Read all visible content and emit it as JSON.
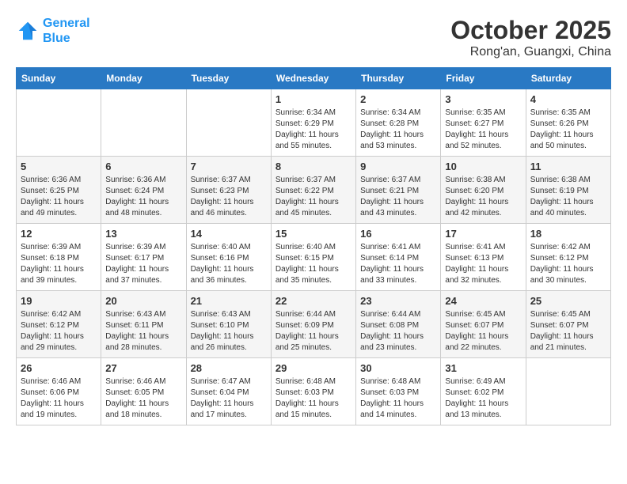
{
  "logo": {
    "line1": "General",
    "line2": "Blue"
  },
  "title": "October 2025",
  "subtitle": "Rong'an, Guangxi, China",
  "weekdays": [
    "Sunday",
    "Monday",
    "Tuesday",
    "Wednesday",
    "Thursday",
    "Friday",
    "Saturday"
  ],
  "weeks": [
    [
      {
        "day": "",
        "info": ""
      },
      {
        "day": "",
        "info": ""
      },
      {
        "day": "",
        "info": ""
      },
      {
        "day": "1",
        "info": "Sunrise: 6:34 AM\nSunset: 6:29 PM\nDaylight: 11 hours\nand 55 minutes."
      },
      {
        "day": "2",
        "info": "Sunrise: 6:34 AM\nSunset: 6:28 PM\nDaylight: 11 hours\nand 53 minutes."
      },
      {
        "day": "3",
        "info": "Sunrise: 6:35 AM\nSunset: 6:27 PM\nDaylight: 11 hours\nand 52 minutes."
      },
      {
        "day": "4",
        "info": "Sunrise: 6:35 AM\nSunset: 6:26 PM\nDaylight: 11 hours\nand 50 minutes."
      }
    ],
    [
      {
        "day": "5",
        "info": "Sunrise: 6:36 AM\nSunset: 6:25 PM\nDaylight: 11 hours\nand 49 minutes."
      },
      {
        "day": "6",
        "info": "Sunrise: 6:36 AM\nSunset: 6:24 PM\nDaylight: 11 hours\nand 48 minutes."
      },
      {
        "day": "7",
        "info": "Sunrise: 6:37 AM\nSunset: 6:23 PM\nDaylight: 11 hours\nand 46 minutes."
      },
      {
        "day": "8",
        "info": "Sunrise: 6:37 AM\nSunset: 6:22 PM\nDaylight: 11 hours\nand 45 minutes."
      },
      {
        "day": "9",
        "info": "Sunrise: 6:37 AM\nSunset: 6:21 PM\nDaylight: 11 hours\nand 43 minutes."
      },
      {
        "day": "10",
        "info": "Sunrise: 6:38 AM\nSunset: 6:20 PM\nDaylight: 11 hours\nand 42 minutes."
      },
      {
        "day": "11",
        "info": "Sunrise: 6:38 AM\nSunset: 6:19 PM\nDaylight: 11 hours\nand 40 minutes."
      }
    ],
    [
      {
        "day": "12",
        "info": "Sunrise: 6:39 AM\nSunset: 6:18 PM\nDaylight: 11 hours\nand 39 minutes."
      },
      {
        "day": "13",
        "info": "Sunrise: 6:39 AM\nSunset: 6:17 PM\nDaylight: 11 hours\nand 37 minutes."
      },
      {
        "day": "14",
        "info": "Sunrise: 6:40 AM\nSunset: 6:16 PM\nDaylight: 11 hours\nand 36 minutes."
      },
      {
        "day": "15",
        "info": "Sunrise: 6:40 AM\nSunset: 6:15 PM\nDaylight: 11 hours\nand 35 minutes."
      },
      {
        "day": "16",
        "info": "Sunrise: 6:41 AM\nSunset: 6:14 PM\nDaylight: 11 hours\nand 33 minutes."
      },
      {
        "day": "17",
        "info": "Sunrise: 6:41 AM\nSunset: 6:13 PM\nDaylight: 11 hours\nand 32 minutes."
      },
      {
        "day": "18",
        "info": "Sunrise: 6:42 AM\nSunset: 6:12 PM\nDaylight: 11 hours\nand 30 minutes."
      }
    ],
    [
      {
        "day": "19",
        "info": "Sunrise: 6:42 AM\nSunset: 6:12 PM\nDaylight: 11 hours\nand 29 minutes."
      },
      {
        "day": "20",
        "info": "Sunrise: 6:43 AM\nSunset: 6:11 PM\nDaylight: 11 hours\nand 28 minutes."
      },
      {
        "day": "21",
        "info": "Sunrise: 6:43 AM\nSunset: 6:10 PM\nDaylight: 11 hours\nand 26 minutes."
      },
      {
        "day": "22",
        "info": "Sunrise: 6:44 AM\nSunset: 6:09 PM\nDaylight: 11 hours\nand 25 minutes."
      },
      {
        "day": "23",
        "info": "Sunrise: 6:44 AM\nSunset: 6:08 PM\nDaylight: 11 hours\nand 23 minutes."
      },
      {
        "day": "24",
        "info": "Sunrise: 6:45 AM\nSunset: 6:07 PM\nDaylight: 11 hours\nand 22 minutes."
      },
      {
        "day": "25",
        "info": "Sunrise: 6:45 AM\nSunset: 6:07 PM\nDaylight: 11 hours\nand 21 minutes."
      }
    ],
    [
      {
        "day": "26",
        "info": "Sunrise: 6:46 AM\nSunset: 6:06 PM\nDaylight: 11 hours\nand 19 minutes."
      },
      {
        "day": "27",
        "info": "Sunrise: 6:46 AM\nSunset: 6:05 PM\nDaylight: 11 hours\nand 18 minutes."
      },
      {
        "day": "28",
        "info": "Sunrise: 6:47 AM\nSunset: 6:04 PM\nDaylight: 11 hours\nand 17 minutes."
      },
      {
        "day": "29",
        "info": "Sunrise: 6:48 AM\nSunset: 6:03 PM\nDaylight: 11 hours\nand 15 minutes."
      },
      {
        "day": "30",
        "info": "Sunrise: 6:48 AM\nSunset: 6:03 PM\nDaylight: 11 hours\nand 14 minutes."
      },
      {
        "day": "31",
        "info": "Sunrise: 6:49 AM\nSunset: 6:02 PM\nDaylight: 11 hours\nand 13 minutes."
      },
      {
        "day": "",
        "info": ""
      }
    ]
  ]
}
